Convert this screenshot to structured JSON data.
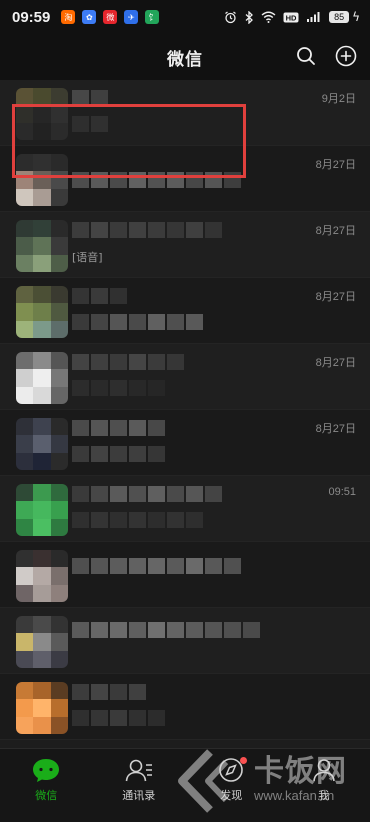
{
  "status_bar": {
    "time": "09:59",
    "left_apps": [
      "淘",
      "✿",
      "微",
      "✈",
      "饣"
    ],
    "battery": "85",
    "right_icons": [
      "alarm-icon",
      "bluetooth-icon",
      "wifi-icon",
      "hd-icon",
      "signal-icon"
    ]
  },
  "header": {
    "title": "微信"
  },
  "chats": [
    {
      "time": "9月2日",
      "preview": ""
    },
    {
      "time": "8月27日",
      "preview": ""
    },
    {
      "time": "8月27日",
      "preview": "[语音]"
    },
    {
      "time": "8月27日",
      "preview": ""
    },
    {
      "time": "8月27日",
      "preview": ""
    },
    {
      "time": "8月27日",
      "preview": ""
    },
    {
      "time": "09:51",
      "preview": ""
    },
    {
      "time": "",
      "preview": ""
    },
    {
      "time": "",
      "preview": ""
    },
    {
      "time": "",
      "preview": ""
    }
  ],
  "tabs": [
    {
      "label": "微信"
    },
    {
      "label": "通讯录"
    },
    {
      "label": "发现"
    },
    {
      "label": "我"
    }
  ],
  "colors": {
    "accent": "#1aad19",
    "highlight": "#e0403d",
    "badge": "#fa5151"
  },
  "watermark": {
    "text": "卡饭网"
  }
}
